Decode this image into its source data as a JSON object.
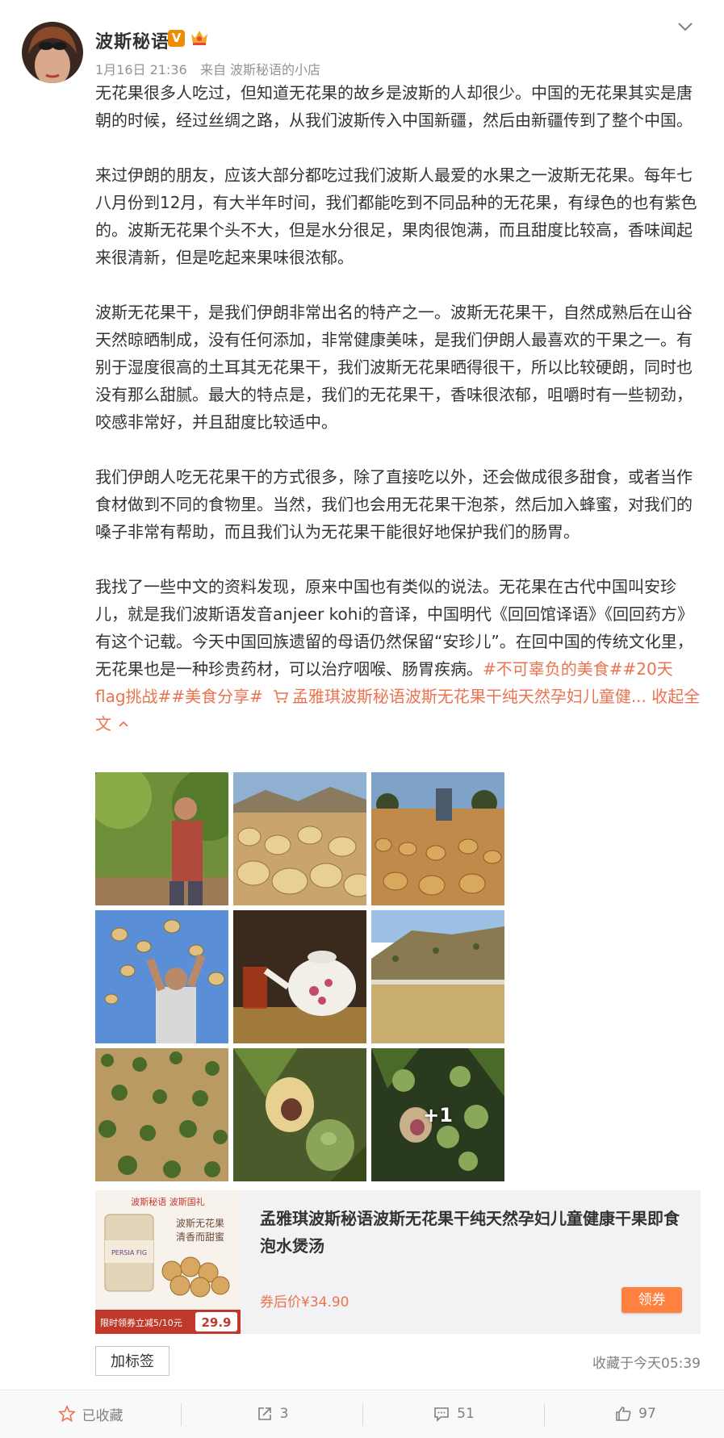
{
  "post": {
    "author": {
      "name": "波斯秘语",
      "verified_badge": "V"
    },
    "meta": {
      "time": "1月16日 21:36",
      "source_prefix": "来自",
      "source": "波斯秘语的小店"
    },
    "paragraphs": [
      "无花果很多人吃过，但知道无花果的故乡是波斯的人却很少。中国的无花果其实是唐朝的时候，经过丝绸之路，从我们波斯传入中国新疆，然后由新疆传到了整个中国。",
      "来过伊朗的朋友，应该大部分都吃过我们波斯人最爱的水果之一波斯无花果。每年七八月份到12月，有大半年时间，我们都能吃到不同品种的无花果，有绿色的也有紫色的。波斯无花果个头不大，但是水分很足，果肉很饱满，而且甜度比较高，香味闻起来很清新，但是吃起来果味很浓郁。",
      "波斯无花果干，是我们伊朗非常出名的特产之一。波斯无花果干，自然成熟后在山谷天然晾晒制成，没有任何添加，非常健康美味，是我们伊朗人最喜欢的干果之一。有别于湿度很高的土耳其无花果干，我们波斯无花果晒得很干，所以比较硬朗，同时也没有那么甜腻。最大的特点是，我们的无花果干，香味很浓郁，咀嚼时有一些韧劲，咬感非常好，并且甜度比较适中。",
      "我们伊朗人吃无花果干的方式很多，除了直接吃以外，还会做成很多甜食，或者当作食材做到不同的食物里。当然，我们也会用无花果干泡茶，然后加入蜂蜜，对我们的嗓子非常有帮助，而且我们认为无花果干能很好地保护我们的肠胃。"
    ],
    "last_paragraph": "我找了一些中文的资料发现，原来中国也有类似的说法。无花果在古代中国叫安珍儿，就是我们波斯语发音anjeer kohi的音译，中国明代《回回馆译语》《回回药方》有这个记载。今天中国回族遗留的母语仍然保留“安珍儿”。在回中国的传统文化里，无花果也是一种珍贵药材，可以治疗咽喉、肠胃疾病。",
    "hashtags": [
      "#不可辜负的美食#",
      "#20天flag挑战#",
      "#美食分享#"
    ],
    "product_link": "孟雅琪波斯秘语波斯无花果干纯天然孕妇儿童健...",
    "collapse_label": "收起全文",
    "more_images_label": "+1",
    "product": {
      "title": "孟雅琪波斯秘语波斯无花果干纯天然孕妇儿童健康干果即食泡水煲汤",
      "price": "券后价¥34.90",
      "coupon_button": "领券",
      "image_text": {
        "brand": "波斯秘语 波斯国礼",
        "slogan_line1": "波斯无花果",
        "slogan_line2": "清香而甜蜜",
        "jar_label": "PERSIA FIG",
        "promo": "限时领券立减5/10元",
        "promo_price": "29.9"
      }
    },
    "tag_button": "加标签",
    "favorited_time": "收藏于今天05:39",
    "actions": {
      "favorite_label": "已收藏",
      "repost_count": "3",
      "comment_count": "51",
      "like_count": "97"
    }
  },
  "colors": {
    "link": "#eb7350",
    "coupon_button": "#ff8140",
    "verified_badge": "#f08c00"
  }
}
